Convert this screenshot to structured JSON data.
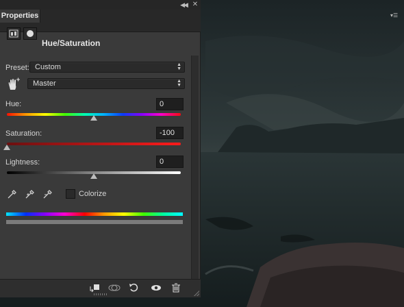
{
  "panel": {
    "tab_label": "Properties",
    "title": "Hue/Saturation",
    "preset_label": "Preset:",
    "preset_value": "Custom",
    "channel_value": "Master",
    "hue_label": "Hue:",
    "hue_value": "0",
    "hue_level": 0.5,
    "saturation_label": "Saturation:",
    "saturation_value": "-100",
    "saturation_level": 0.0,
    "lightness_label": "Lightness:",
    "lightness_value": "0",
    "lightness_level": 0.5,
    "colorize_label": "Colorize",
    "colorize_checked": false
  },
  "icons": {
    "collapse": "double-chevron-left-icon",
    "close": "close-icon",
    "panel_menu": "panel-menu-icon",
    "adjustment": "adjustment-layer-icon",
    "mask": "layer-mask-icon",
    "targeted_adjust": "hand-adjust-icon",
    "eyedropper": "eyedropper-icon",
    "eyedropper_plus": "eyedropper-add-icon",
    "eyedropper_minus": "eyedropper-subtract-icon",
    "clip": "clip-to-layer-icon",
    "view_previous": "view-previous-state-icon",
    "reset": "reset-icon",
    "visibility": "eye-icon",
    "delete": "trash-icon"
  },
  "colors": {
    "panel_bg": "#3a3a3a",
    "tab_bg": "#282828",
    "saturation_track": "#ff1b1b"
  }
}
